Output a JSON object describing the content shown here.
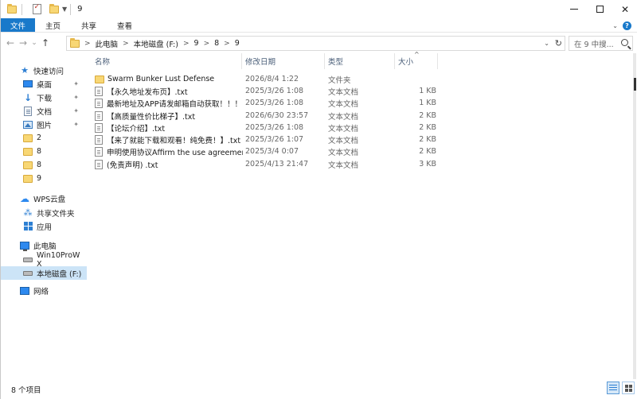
{
  "window": {
    "title": "9",
    "controls": {
      "minimize": "minimize",
      "maximize": "maximize",
      "close": "✕"
    }
  },
  "ribbon": {
    "tabs": [
      {
        "label": "文件",
        "active": true
      },
      {
        "label": "主页",
        "active": false
      },
      {
        "label": "共享",
        "active": false
      },
      {
        "label": "查看",
        "active": false
      }
    ],
    "expand_icon": "chevron-down-icon",
    "help": "?"
  },
  "address": {
    "back": "←",
    "forward": "→",
    "recent": "⌄",
    "up": "↑",
    "breadcrumb": [
      "此电脑",
      "本地磁盘 (F:)",
      "9",
      "8",
      "9"
    ],
    "separator": ">",
    "refresh": "↻",
    "search_placeholder": "在 9 中搜..."
  },
  "nav": {
    "items": [
      {
        "label": "快速访问",
        "icon": "star-icon",
        "pinned": false
      },
      {
        "label": "桌面",
        "icon": "desktop-icon",
        "pinned": true
      },
      {
        "label": "下载",
        "icon": "download-icon",
        "pinned": true
      },
      {
        "label": "文档",
        "icon": "documents-icon",
        "pinned": true
      },
      {
        "label": "图片",
        "icon": "pictures-icon",
        "pinned": true
      },
      {
        "label": "2",
        "icon": "folder-icon",
        "pinned": false
      },
      {
        "label": "8",
        "icon": "folder-icon",
        "pinned": false
      },
      {
        "label": "8",
        "icon": "folder-icon",
        "pinned": false
      },
      {
        "label": "9",
        "icon": "folder-icon",
        "pinned": false
      },
      {
        "label": "WPS云盘",
        "icon": "cloud-icon",
        "pinned": false
      },
      {
        "label": "共享文件夹",
        "icon": "share-icon",
        "pinned": false
      },
      {
        "label": "应用",
        "icon": "apps-icon",
        "pinned": false
      },
      {
        "label": "此电脑",
        "icon": "pc-icon",
        "pinned": false
      },
      {
        "label": "Win10ProW X",
        "icon": "drive-icon",
        "pinned": false
      },
      {
        "label": "本地磁盘 (F:)",
        "icon": "drive-icon",
        "pinned": false,
        "selected": true
      },
      {
        "label": "网络",
        "icon": "network-icon",
        "pinned": false
      }
    ],
    "pin_glyph": "📌"
  },
  "list": {
    "columns": {
      "name": "名称",
      "date": "修改日期",
      "type": "类型",
      "size": "大小"
    },
    "sort_glyph": "^",
    "rows": [
      {
        "name": "Swarm Bunker Lust Defense",
        "date": "2026/8/4 1:22",
        "type": "文件夹",
        "size": "",
        "kind": "folder"
      },
      {
        "name": "【永久地址发布页】.txt",
        "date": "2025/3/26 1:08",
        "type": "文本文档",
        "size": "1 KB",
        "kind": "txt"
      },
      {
        "name": "最新地址及APP请发邮箱自动获取！！！....",
        "date": "2025/3/26 1:08",
        "type": "文本文档",
        "size": "1 KB",
        "kind": "txt"
      },
      {
        "name": "【高质量性价比梯子】.txt",
        "date": "2026/6/30 23:57",
        "type": "文本文档",
        "size": "2 KB",
        "kind": "txt"
      },
      {
        "name": "【论坛介绍】.txt",
        "date": "2025/3/26 1:08",
        "type": "文本文档",
        "size": "2 KB",
        "kind": "txt"
      },
      {
        "name": "【来了就能下载和观看！纯免费！】.txt",
        "date": "2025/3/26 1:07",
        "type": "文本文档",
        "size": "2 KB",
        "kind": "txt"
      },
      {
        "name": "申明使用协议Affirm the use agreemen...",
        "date": "2025/3/4 0:07",
        "type": "文本文档",
        "size": "2 KB",
        "kind": "txt"
      },
      {
        "name": "(免责声明) .txt",
        "date": "2025/4/13 21:47",
        "type": "文本文档",
        "size": "3 KB",
        "kind": "txt"
      }
    ]
  },
  "status": {
    "count": "8 个项目"
  },
  "colors": {
    "accent": "#1979ca",
    "selected": "#cce4f7",
    "folder": "#f8d775"
  }
}
